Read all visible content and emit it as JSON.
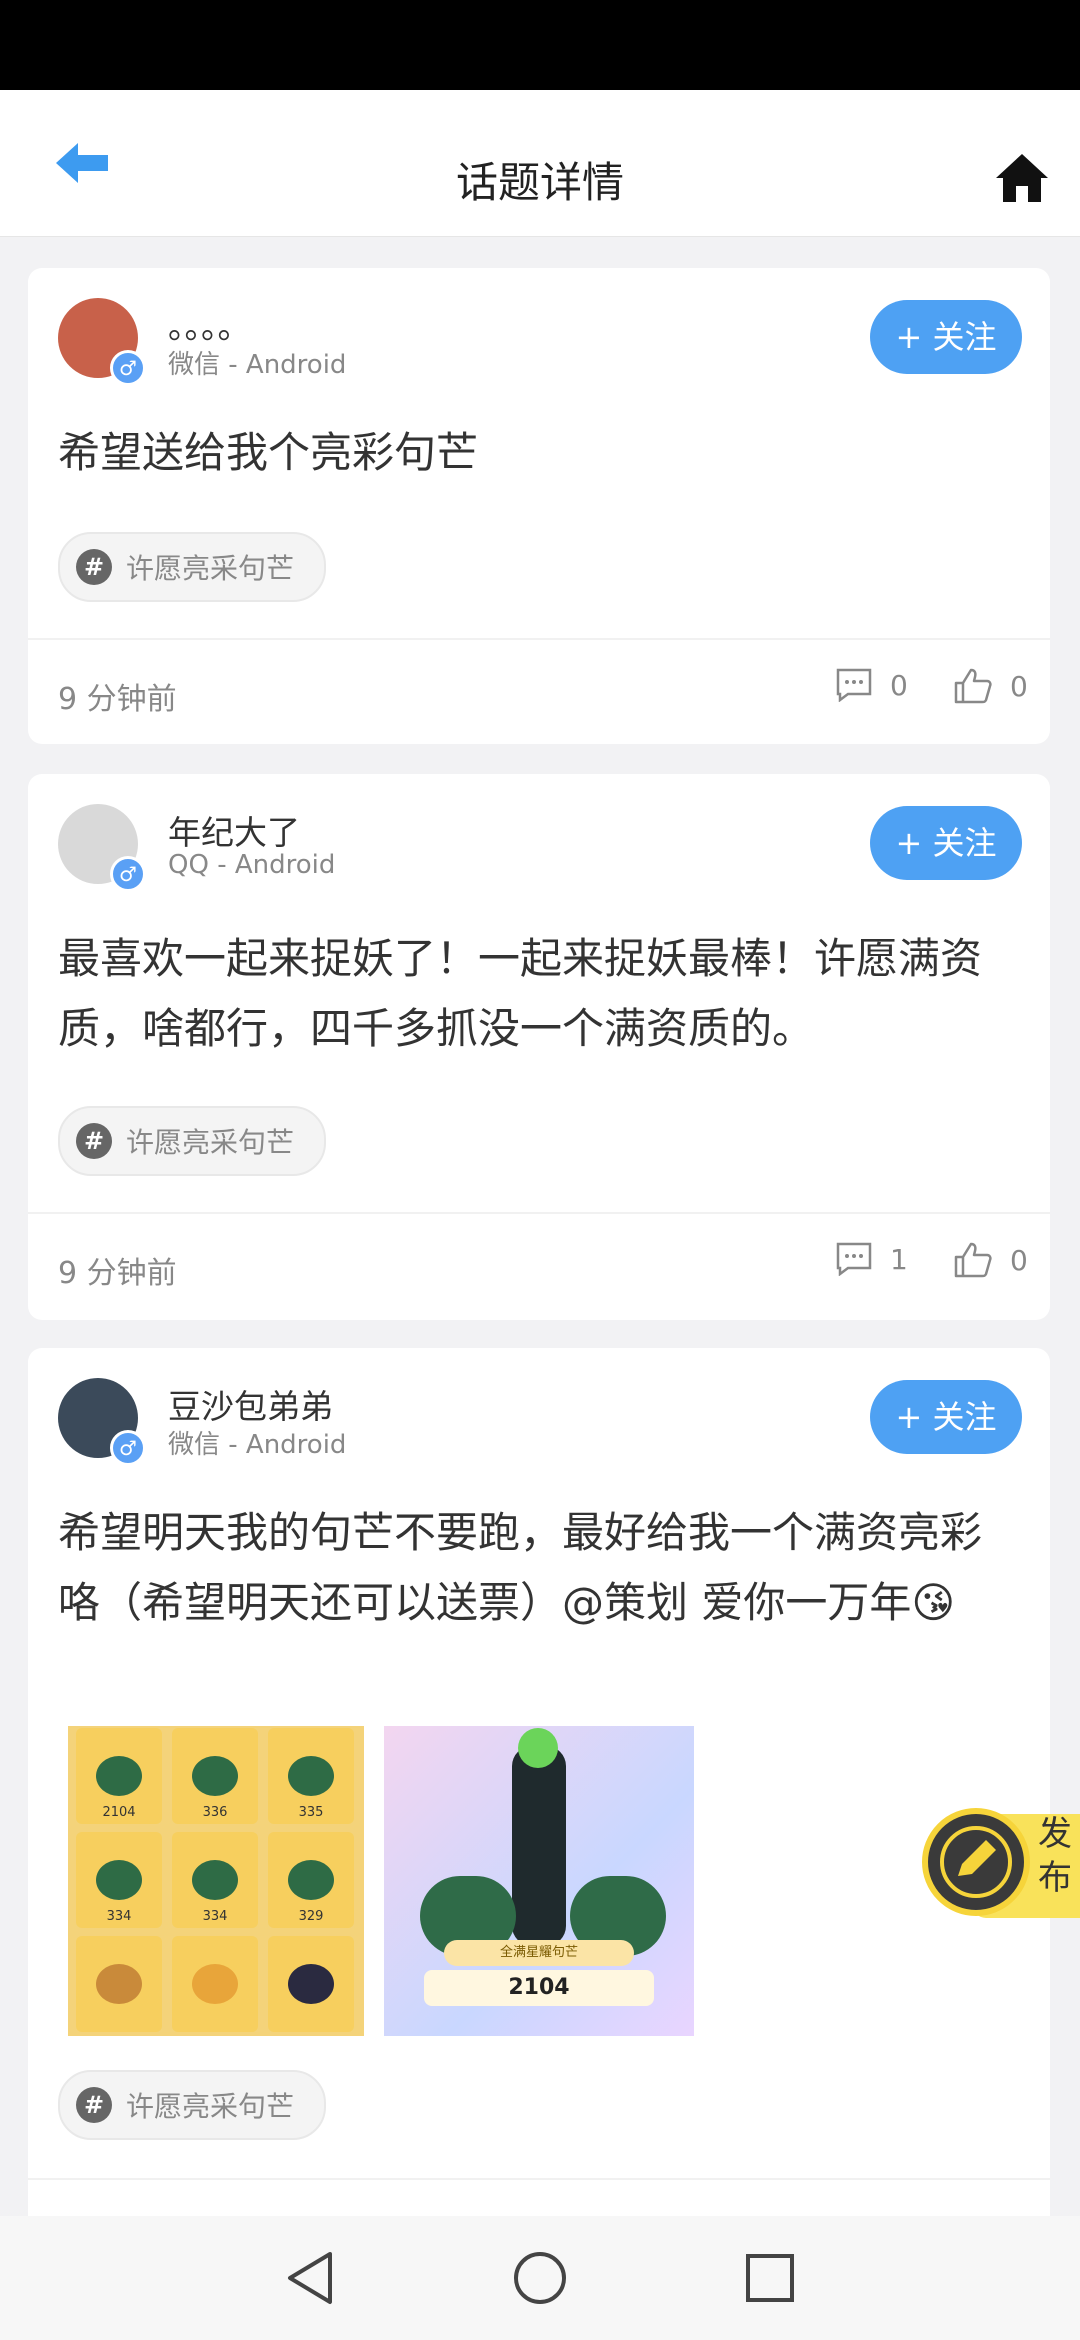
{
  "header": {
    "title": "话题详情"
  },
  "posts": [
    {
      "name": "。。。。",
      "source": "微信 - Android",
      "follow_label": "+ 关注",
      "content": "希望送给我个亮彩句芒",
      "tag": "许愿亮采句芒",
      "time": "9 分钟前",
      "comments": "0",
      "likes": "0",
      "avatar_color": "#c8614a"
    },
    {
      "name": "年纪大了",
      "source": "QQ - Android",
      "follow_label": "+ 关注",
      "content": "最喜欢一起来捉妖了！一起来捉妖最棒！许愿满资质，啥都行，四千多抓没一个满资质的。",
      "tag": "许愿亮采句芒",
      "time": "9 分钟前",
      "comments": "1",
      "likes": "0",
      "avatar_color": "#d9d9d9"
    },
    {
      "name": "豆沙包弟弟",
      "source": "微信 - Android",
      "follow_label": "+ 关注",
      "content": "希望明天我的句芒不要跑，最好给我一个满资亮彩咯（希望明天还可以送票）@策划  爱你一万年😘",
      "tag": "许愿亮采句芒",
      "avatar_color": "#3b4a5a",
      "images": {
        "grid_numbers": [
          "2104",
          "336",
          "335",
          "334",
          "334",
          "329"
        ],
        "detail_title": "全满星耀句芒",
        "detail_score": "2104"
      }
    }
  ],
  "publish": {
    "label": "发布"
  },
  "colors": {
    "accent": "#4ea1f3",
    "publish_yellow": "#f9e25a"
  }
}
